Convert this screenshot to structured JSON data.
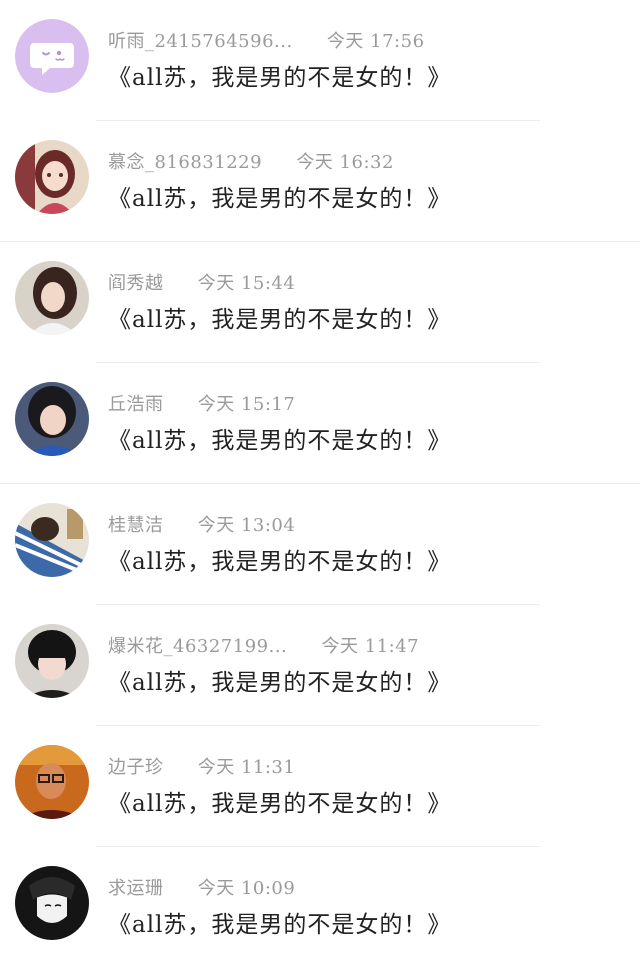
{
  "comments": [
    {
      "username": "听雨_2415764596...",
      "time": "今天 17:56",
      "message": "《all苏，我是男的不是女的！》",
      "avatar_icon": "chat-bubble-default-avatar-icon",
      "avatar_color": "#d8bff0"
    },
    {
      "username": "慕念_816831229",
      "time": "今天 16:32",
      "message": "《all苏，我是男的不是女的！》",
      "avatar_icon": "anime-girl-avatar",
      "avatar_color": "#c0505a"
    },
    {
      "username": "阎秀越",
      "time": "今天 15:44",
      "message": "《all苏，我是男的不是女的！》",
      "avatar_icon": "user-photo-avatar",
      "avatar_color": "#6a4a40"
    },
    {
      "username": "丘浩雨",
      "time": "今天 15:17",
      "message": "《all苏，我是男的不是女的！》",
      "avatar_icon": "user-photo-avatar",
      "avatar_color": "#2a2a2e"
    },
    {
      "username": "桂慧洁",
      "time": "今天 13:04",
      "message": "《all苏，我是男的不是女的！》",
      "avatar_icon": "user-photo-avatar",
      "avatar_color": "#3c6aa8"
    },
    {
      "username": "爆米花_46327199...",
      "time": "今天 11:47",
      "message": "《all苏，我是男的不是女的！》",
      "avatar_icon": "user-photo-avatar",
      "avatar_color": "#1e1e1e"
    },
    {
      "username": "边子珍",
      "time": "今天 11:31",
      "message": "《all苏，我是男的不是女的！》",
      "avatar_icon": "user-photo-avatar",
      "avatar_color": "#c04a1a"
    },
    {
      "username": "求运珊",
      "time": "今天 10:09",
      "message": "《all苏，我是男的不是女的！》",
      "avatar_icon": "sketch-avatar",
      "avatar_color": "#151515"
    }
  ]
}
